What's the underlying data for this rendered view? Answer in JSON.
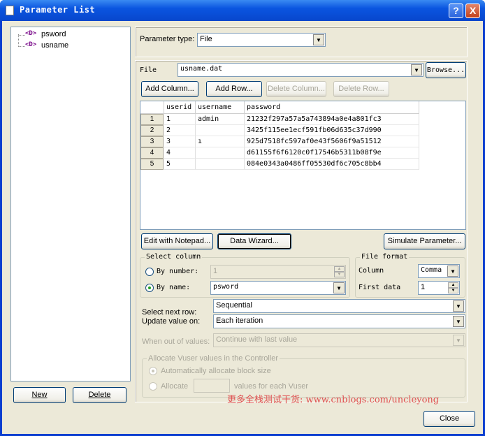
{
  "window": {
    "title": "Parameter List",
    "help_glyph": "?",
    "close_glyph": "X"
  },
  "tree": {
    "items": [
      {
        "icon": "<D>",
        "label": "psword"
      },
      {
        "icon": "<D>",
        "label": "usname"
      }
    ]
  },
  "left_buttons": {
    "new": "New",
    "delete": "Delete"
  },
  "param_type": {
    "label": "Parameter type:",
    "value": "File"
  },
  "file": {
    "label": "File",
    "value": "usname.dat",
    "browse": "Browse..."
  },
  "toolbar": {
    "add_column": "Add Column...",
    "add_row": "Add Row...",
    "delete_column": "Delete Column...",
    "delete_row": "Delete Row..."
  },
  "table": {
    "headers": [
      "userid",
      "username",
      "password"
    ],
    "rows": [
      {
        "num": "1",
        "cells": [
          "1",
          "admin",
          "21232f297a57a5a743894a0e4a801fc3"
        ]
      },
      {
        "num": "2",
        "cells": [
          "2",
          "",
          "3425f115ee1ecf591fb06d635c37d990"
        ]
      },
      {
        "num": "3",
        "cells": [
          "3",
          "ı",
          "925d7518fc597af0e43f5606f9a51512"
        ]
      },
      {
        "num": "4",
        "cells": [
          "4",
          "",
          "d61155f6f6120c0f17546b5311b08f9e"
        ]
      },
      {
        "num": "5",
        "cells": [
          "5",
          "",
          "084e0343a0486ff05530df6c705c8bb4"
        ]
      }
    ]
  },
  "actions": {
    "edit_notepad": "Edit with Notepad...",
    "data_wizard": "Data Wizard...",
    "simulate": "Simulate Parameter..."
  },
  "select_column": {
    "title": "Select column",
    "by_number_label": "By number:",
    "by_number_value": "1",
    "by_name_label": "By name:",
    "by_name_value": "psword"
  },
  "file_format": {
    "title": "File format",
    "column_label": "Column",
    "column_value": "Comma",
    "first_data_label": "First data",
    "first_data_value": "1"
  },
  "select_next_row": {
    "label": "Select next row:",
    "value": "Sequential"
  },
  "update_value": {
    "label": "Update value on:",
    "value": "Each iteration"
  },
  "out_of_values": {
    "label": "When out of values:",
    "value": "Continue with last value"
  },
  "allocate": {
    "title": "Allocate Vuser values in the Controller",
    "auto_label": "Automatically allocate block size",
    "allocate_label": "Allocate",
    "values_label": "values for each Vuser",
    "allocate_value": ""
  },
  "close_button": "Close",
  "watermark": "更多全栈测试干货: www.cnblogs.com/uncleyong"
}
